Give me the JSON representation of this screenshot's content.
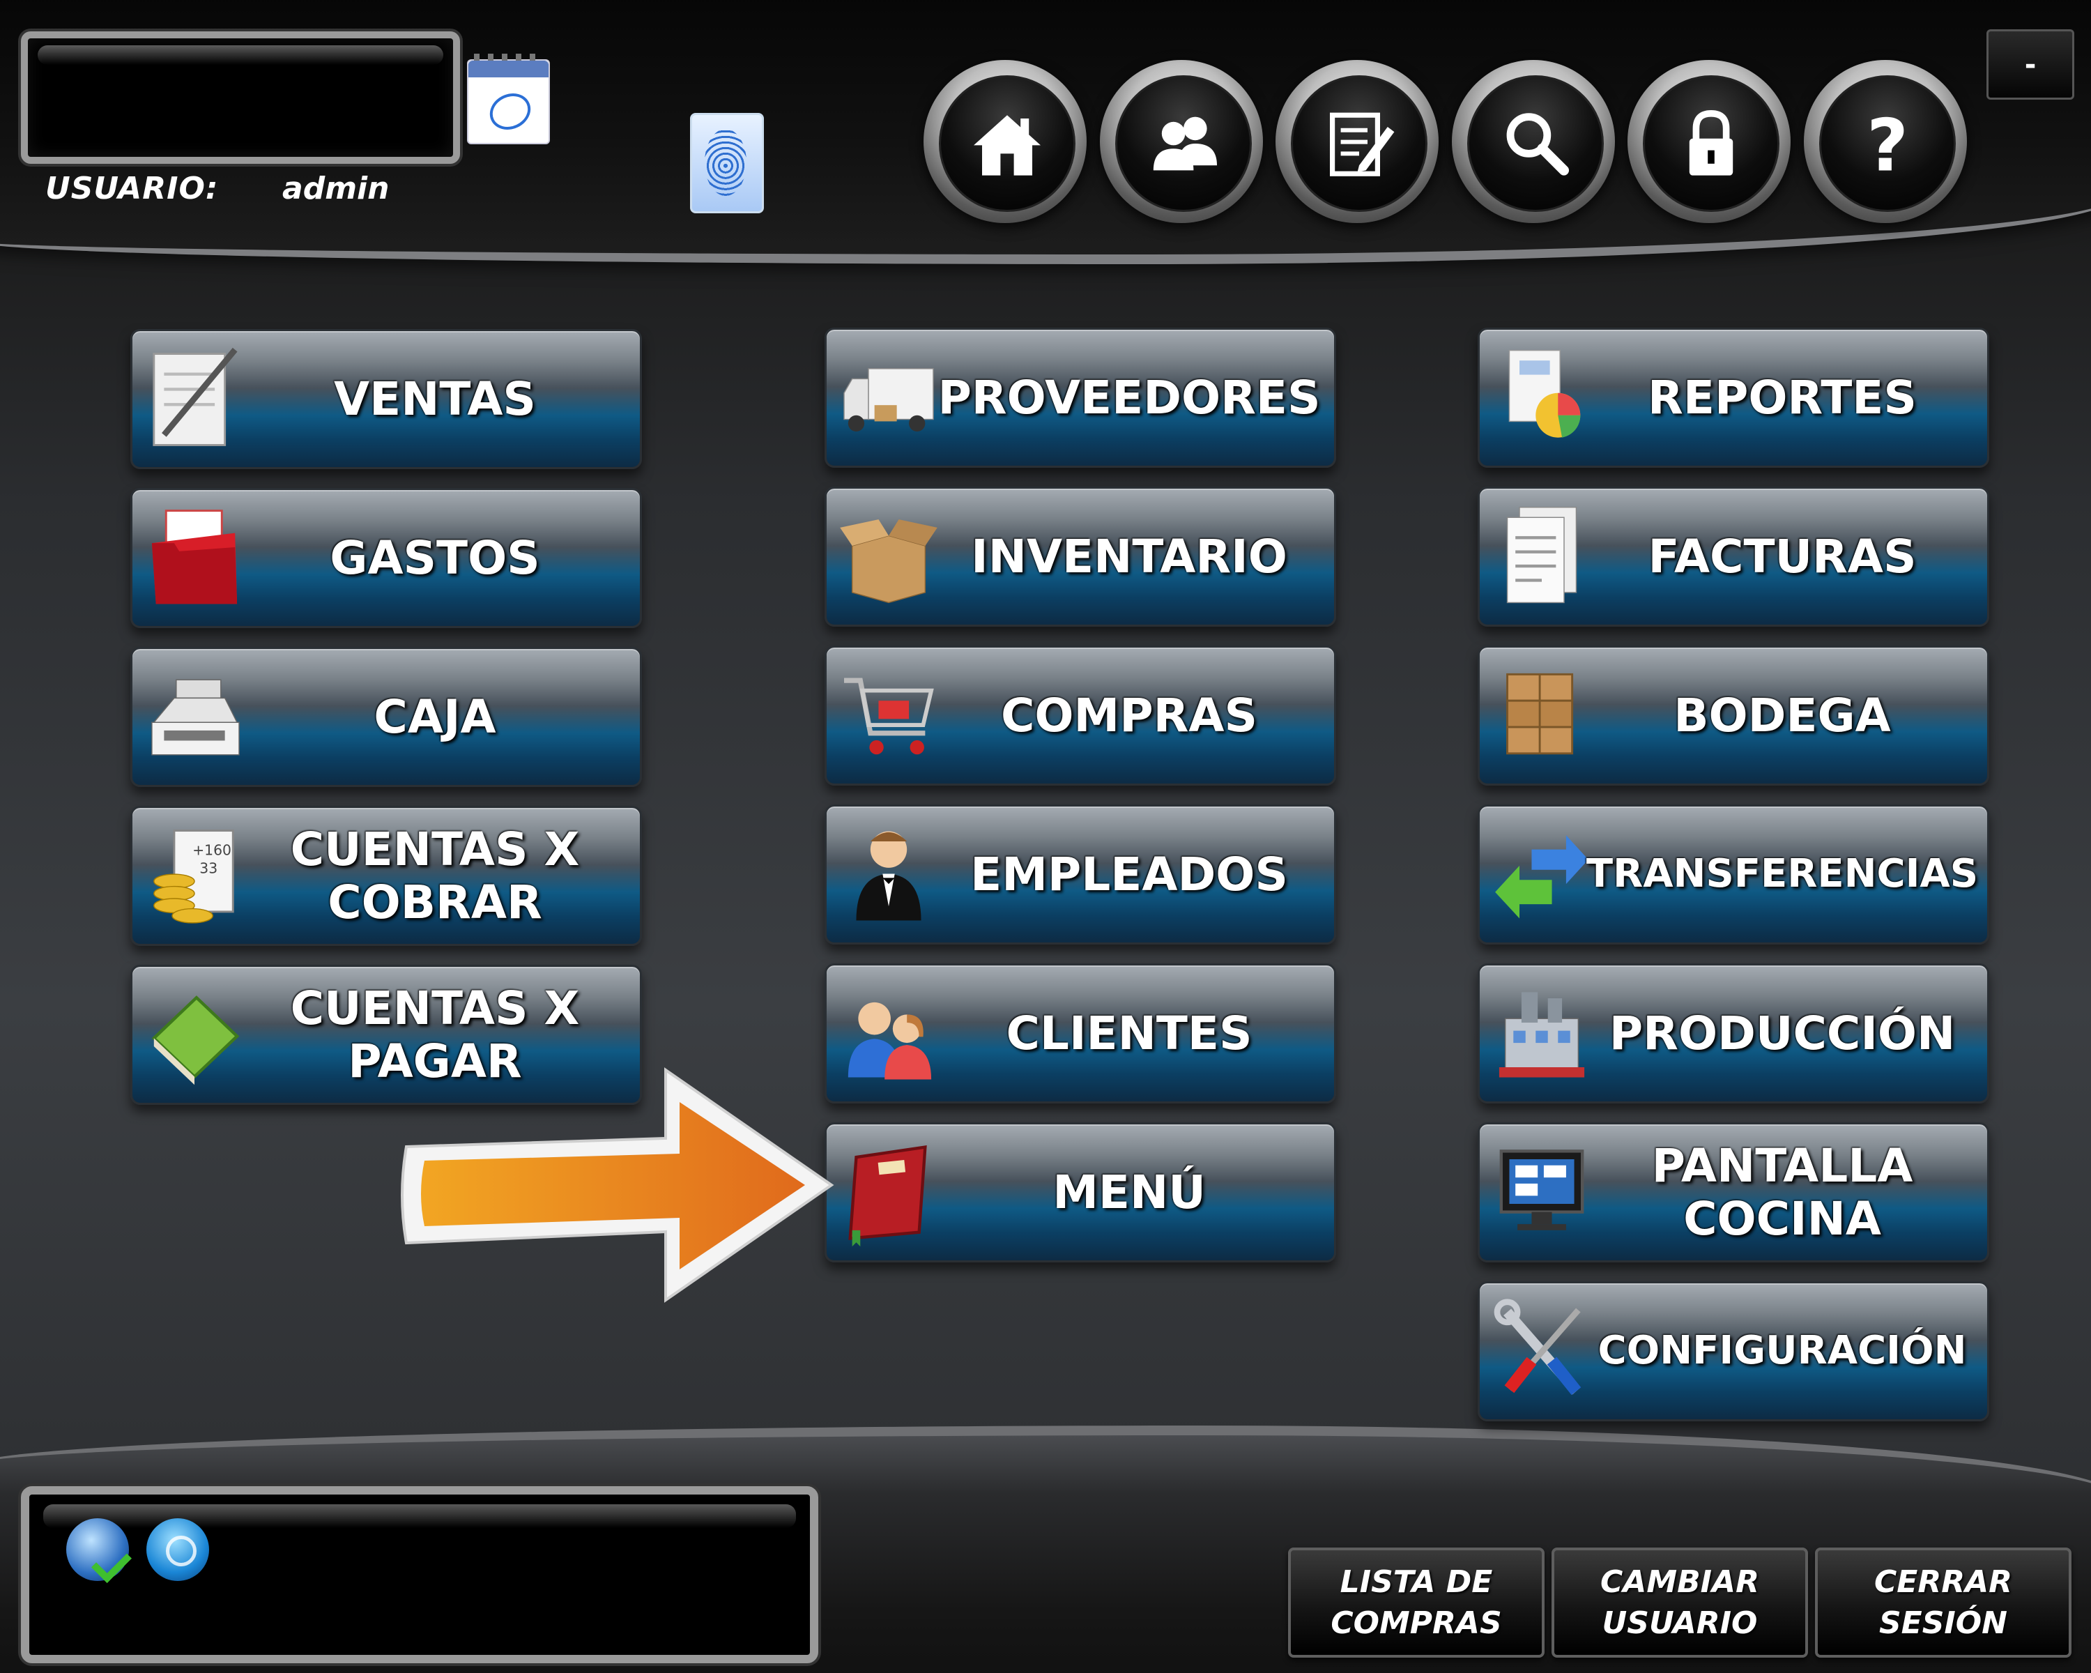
{
  "header": {
    "user_label": "USUARIO:",
    "user_name": "admin",
    "minimize_label": "-"
  },
  "toolbar": {
    "buttons": [
      {
        "name": "home-button",
        "icon": "home-icon"
      },
      {
        "name": "users-button",
        "icon": "users-icon"
      },
      {
        "name": "notes-button",
        "icon": "notepad-icon"
      },
      {
        "name": "search-button",
        "icon": "magnifier-icon"
      },
      {
        "name": "lock-button",
        "icon": "lock-icon"
      },
      {
        "name": "help-button",
        "icon": "question-mark-icon"
      }
    ]
  },
  "modules": {
    "col1": [
      {
        "label": "VENTAS",
        "icon": "pen-paper-icon"
      },
      {
        "label": "GASTOS",
        "icon": "red-folder-icon"
      },
      {
        "label": "CAJA",
        "icon": "cash-register-icon"
      },
      {
        "label": "CUENTAS X\nCOBRAR",
        "icon": "coins-calculation-icon"
      },
      {
        "label": "CUENTAS X\nPAGAR",
        "icon": "green-book-icon"
      }
    ],
    "col2": [
      {
        "label": "PROVEEDORES",
        "icon": "delivery-truck-icon"
      },
      {
        "label": "INVENTARIO",
        "icon": "open-box-icon"
      },
      {
        "label": "COMPRAS",
        "icon": "shopping-cart-icon"
      },
      {
        "label": "EMPLEADOS",
        "icon": "waiter-icon"
      },
      {
        "label": "CLIENTES",
        "icon": "customers-icon"
      },
      {
        "label": "MENÚ",
        "icon": "menu-book-icon"
      }
    ],
    "col3": [
      {
        "label": "REPORTES",
        "icon": "report-chart-icon"
      },
      {
        "label": "FACTURAS",
        "icon": "invoice-icon"
      },
      {
        "label": "BODEGA",
        "icon": "boxes-icon"
      },
      {
        "label": "TRANSFERENCIAS",
        "icon": "transfer-arrows-icon"
      },
      {
        "label": "PRODUCCIÓN",
        "icon": "factory-icon"
      },
      {
        "label": "PANTALLA\nCOCINA",
        "icon": "monitor-icon"
      },
      {
        "label": "CONFIGURACIÓN",
        "icon": "tools-icon"
      }
    ]
  },
  "footer": {
    "status_icons": [
      "globe-check-icon",
      "wireless-icon"
    ],
    "buttons": [
      {
        "label": "LISTA DE\nCOMPRAS"
      },
      {
        "label": "CAMBIAR\nUSUARIO"
      },
      {
        "label": "CERRAR\nSESIÓN"
      }
    ]
  },
  "colors": {
    "accent_blue": "#0f5a85",
    "arrow_orange": "#e8751a"
  }
}
